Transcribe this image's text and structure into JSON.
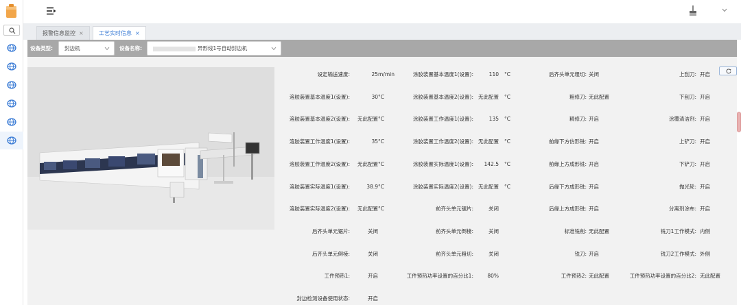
{
  "tabs": [
    {
      "label": "报警信息监控",
      "close": "×"
    },
    {
      "label": "工艺实时信息",
      "close": "×"
    }
  ],
  "filters": {
    "device_type_label": "设备类型:",
    "device_type_value": "封边机",
    "device_name_label": "设备名称:",
    "device_name_value": "异形线1号自动封边机"
  },
  "params": [
    {
      "label": "设定输送速度:",
      "value": "25",
      "unit": "m/min"
    },
    {
      "label": "涂胶装置基本温度1(设置):",
      "value": "110",
      "unit": "°C"
    },
    {
      "label": "后齐头单元粗切:",
      "value": "关闭",
      "unit": ""
    },
    {
      "label": "上刮刀:",
      "value": "开启",
      "unit": ""
    },
    {
      "label": "溶胶装置基本温度1(设置):",
      "value": "30",
      "unit": "°C"
    },
    {
      "label": "涂胶装置基本温度2(设置):",
      "value": "无此配置",
      "unit": "°C"
    },
    {
      "label": "粗修刀:",
      "value": "无此配置",
      "unit": ""
    },
    {
      "label": "下刮刀:",
      "value": "开启",
      "unit": ""
    },
    {
      "label": "溶胶装置基本温度2(设置):",
      "value": "无此配置",
      "unit": "°C"
    },
    {
      "label": "涂胶装置工作温度1(设置):",
      "value": "135",
      "unit": "°C"
    },
    {
      "label": "精修刀:",
      "value": "开启",
      "unit": ""
    },
    {
      "label": "涂覆清洁剂:",
      "value": "开启",
      "unit": ""
    },
    {
      "label": "溶胶装置工作温度1(设置):",
      "value": "35",
      "unit": "°C"
    },
    {
      "label": "涂胶装置工作温度2(设置):",
      "value": "无此配置",
      "unit": "°C"
    },
    {
      "label": "前缘下方仿形铣:",
      "value": "开启",
      "unit": ""
    },
    {
      "label": "上铲刀:",
      "value": "开启",
      "unit": ""
    },
    {
      "label": "溶胶装置工作温度2(设置):",
      "value": "无此配置",
      "unit": "°C"
    },
    {
      "label": "涂胶装置实际温度1(设置):",
      "value": "142.5",
      "unit": "°C"
    },
    {
      "label": "前缘上方成形铣:",
      "value": "开启",
      "unit": ""
    },
    {
      "label": "下铲刀:",
      "value": "开启",
      "unit": ""
    },
    {
      "label": "溶胶装置实际温度1(设置):",
      "value": "38.9",
      "unit": "°C"
    },
    {
      "label": "涂胶装置实际温度2(设置):",
      "value": "无此配置",
      "unit": "°C"
    },
    {
      "label": "后缘下方成形铣:",
      "value": "开启",
      "unit": ""
    },
    {
      "label": "抛光轮:",
      "value": "开启",
      "unit": ""
    },
    {
      "label": "溶胶装置实际温度2(设置):",
      "value": "无此配置",
      "unit": "°C"
    },
    {
      "label": "前齐头单元锯片:",
      "value": "关闭",
      "unit": ""
    },
    {
      "label": "后缘上方成形铣:",
      "value": "开启",
      "unit": ""
    },
    {
      "label": "分离剂涂布:",
      "value": "开启",
      "unit": ""
    },
    {
      "label": "后齐头单元锯片:",
      "value": "关闭",
      "unit": ""
    },
    {
      "label": "前齐头单元倒棱:",
      "value": "关闭",
      "unit": ""
    },
    {
      "label": "标准铣削:",
      "value": "无此配置",
      "unit": ""
    },
    {
      "label": "铣刀1工作模式:",
      "value": "内侧",
      "unit": ""
    },
    {
      "label": "后齐头单元倒棱:",
      "value": "关闭",
      "unit": ""
    },
    {
      "label": "前齐头单元粗切:",
      "value": "关闭",
      "unit": ""
    },
    {
      "label": "铣刀:",
      "value": "开启",
      "unit": ""
    },
    {
      "label": "铣刀2工作模式:",
      "value": "外侧",
      "unit": ""
    },
    {
      "label": "工件预热1:",
      "value": "开启",
      "unit": ""
    },
    {
      "label": "工件预热功率设置的百分比1:",
      "value": "80%",
      "unit": ""
    },
    {
      "label": "工件预热2:",
      "value": "无此配置",
      "unit": ""
    },
    {
      "label": "工件预热功率设置的百分比2:",
      "value": "无此配置",
      "unit": ""
    },
    {
      "label": "封边检测设备使用状态:",
      "value": "开启",
      "unit": ""
    }
  ]
}
